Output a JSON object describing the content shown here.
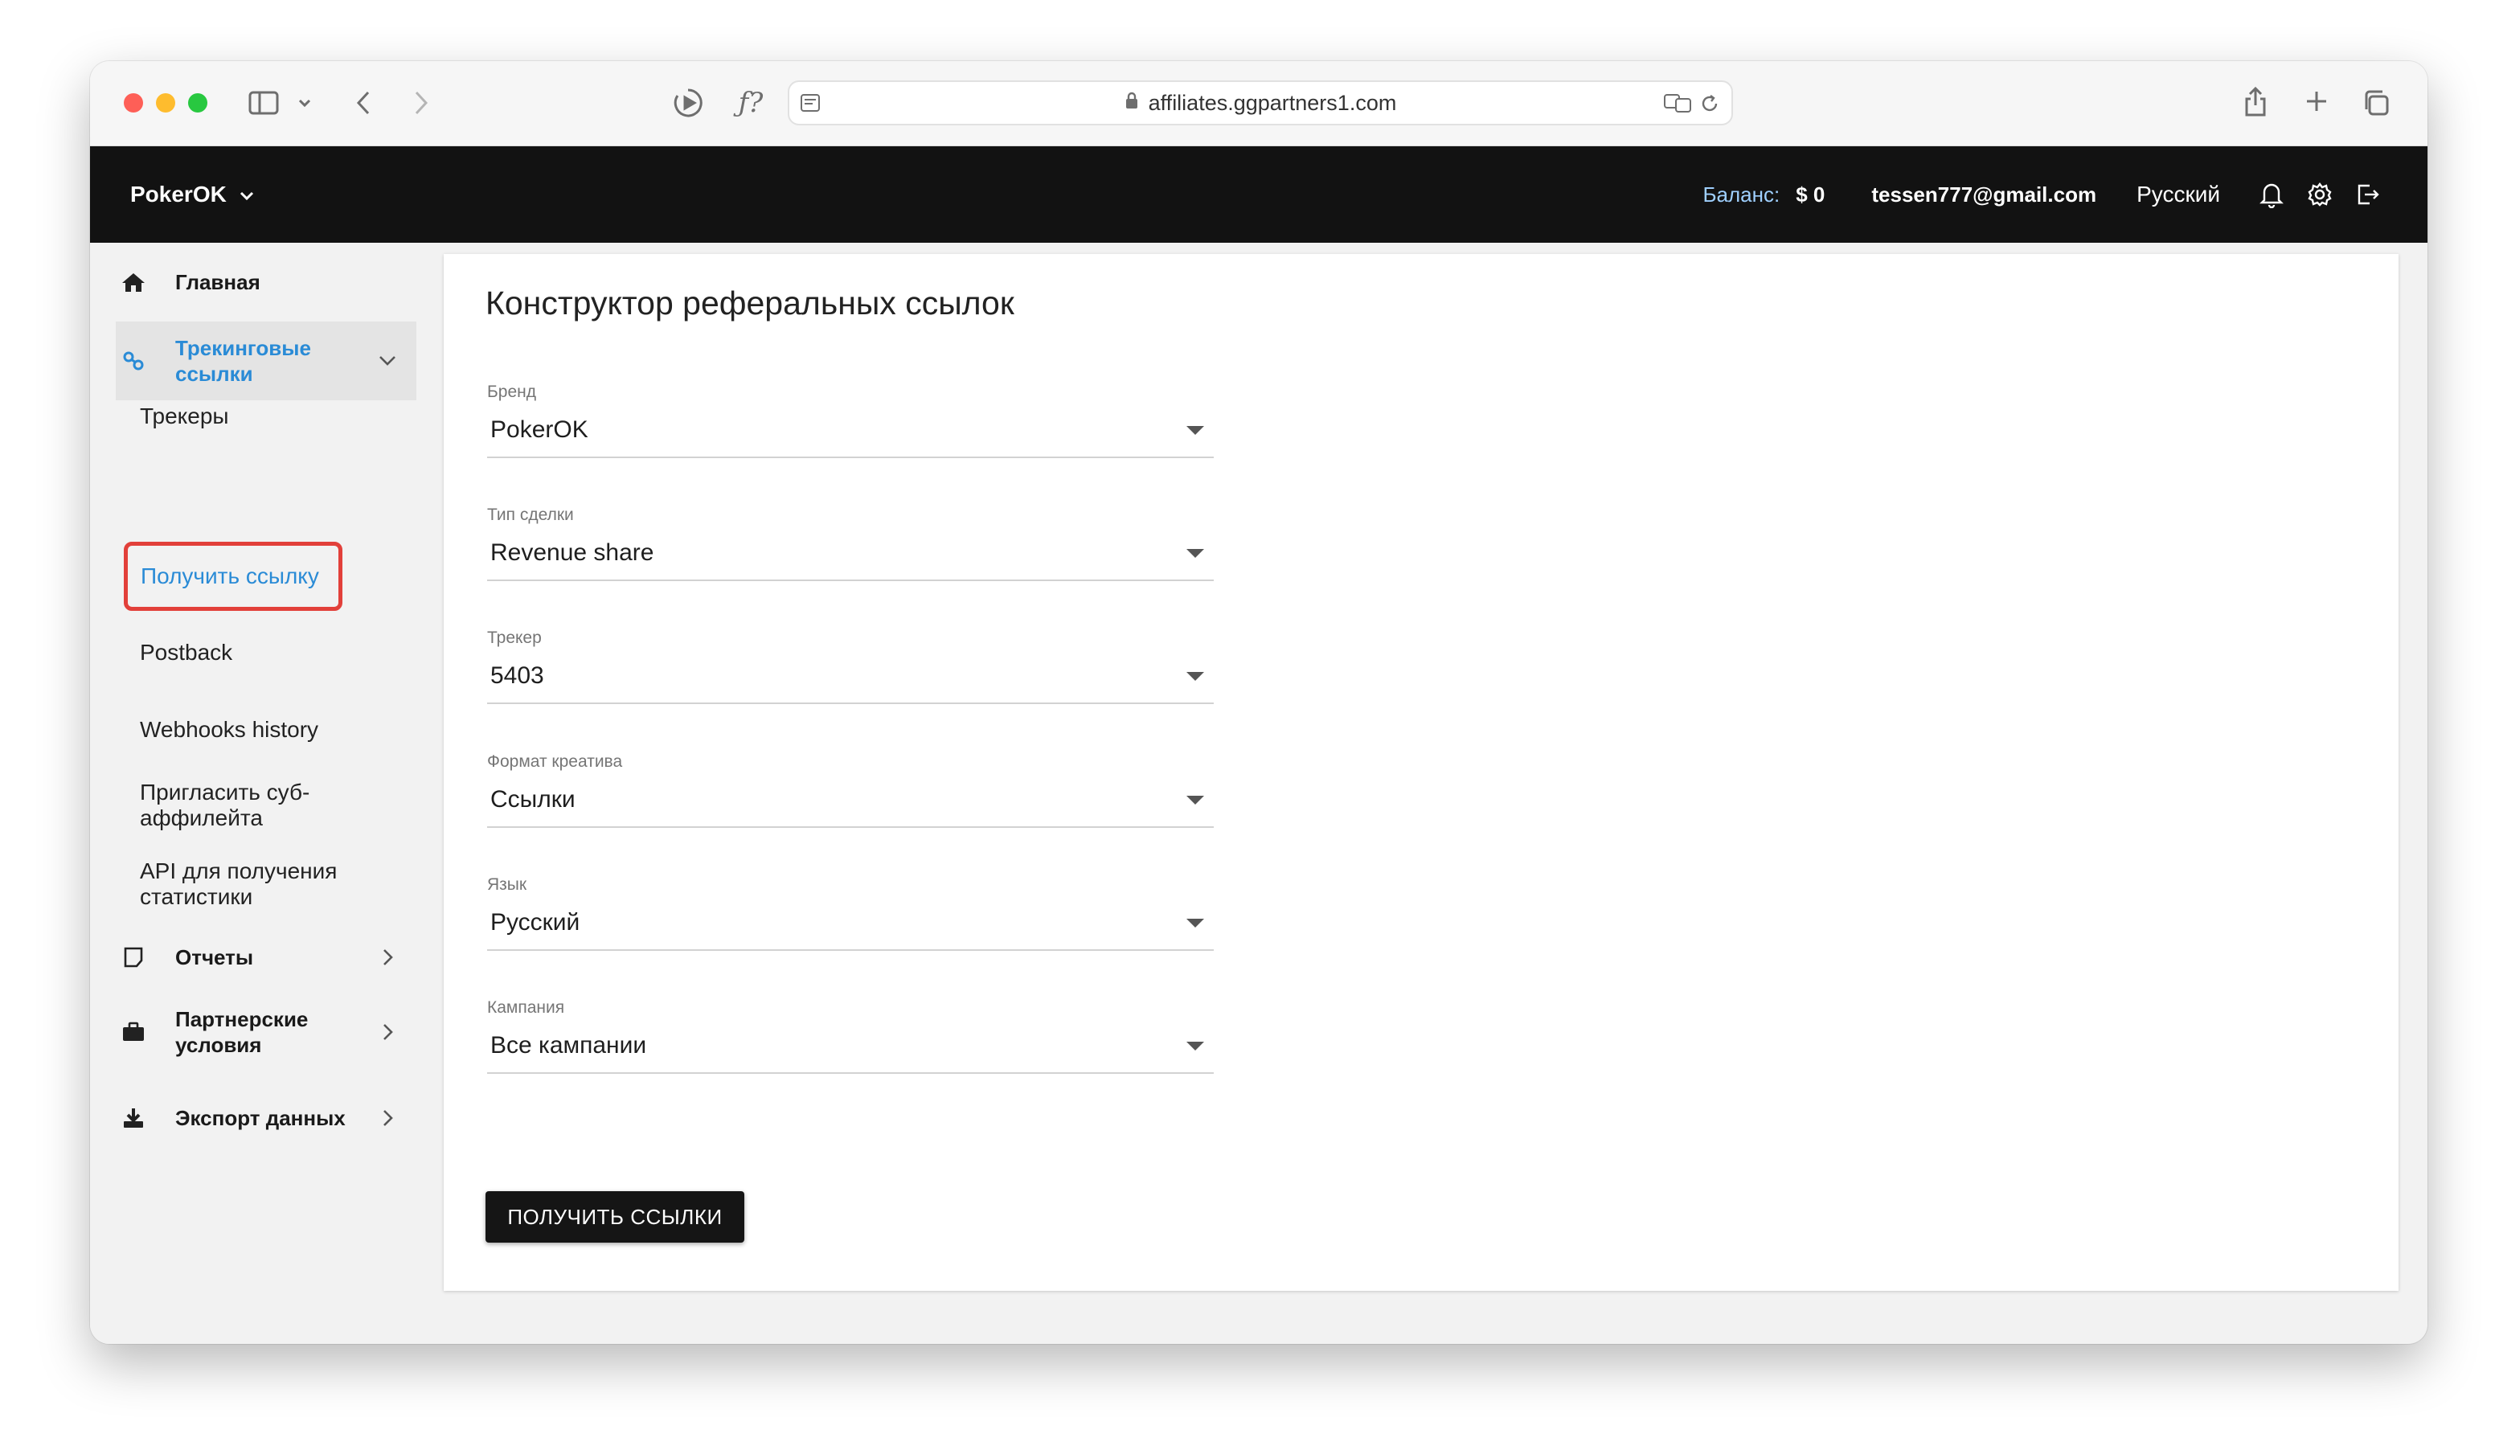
{
  "browser": {
    "url": "affiliates.ggpartners1.com"
  },
  "header": {
    "brand": "PokerOK",
    "balance_label": "Баланс:",
    "balance_value": "$ 0",
    "email": "tessen777@gmail.com",
    "language": "Русский"
  },
  "sidebar": {
    "home": "Главная",
    "tracking_links": "Трекинговые ссылки",
    "sub_items": {
      "trackers": "Трекеры",
      "get_link": "Получить ссылку",
      "postback": "Postback",
      "webhooks": "Webhooks history",
      "invite": "Пригласить суб-аффилейта",
      "api": "API для получения статистики"
    },
    "reports": "Отчеты",
    "partner_terms": "Партнерские условия",
    "export": "Экспорт данных"
  },
  "main": {
    "title": "Конструктор реферальных ссылок",
    "fields": {
      "brand": {
        "label": "Бренд",
        "value": "PokerOK"
      },
      "deal_type": {
        "label": "Тип сделки",
        "value": "Revenue share"
      },
      "tracker": {
        "label": "Трекер",
        "value": "5403"
      },
      "creative_format": {
        "label": "Формат креатива",
        "value": "Ссылки"
      },
      "language": {
        "label": "Язык",
        "value": "Русский"
      },
      "campaign": {
        "label": "Кампания",
        "value": "Все кампании"
      }
    },
    "submit_label": "ПОЛУЧИТЬ ССЫЛКИ"
  },
  "colors": {
    "header_bg": "#121212",
    "accent_blue": "#2a8bd6",
    "highlight_red": "#e2403a"
  }
}
